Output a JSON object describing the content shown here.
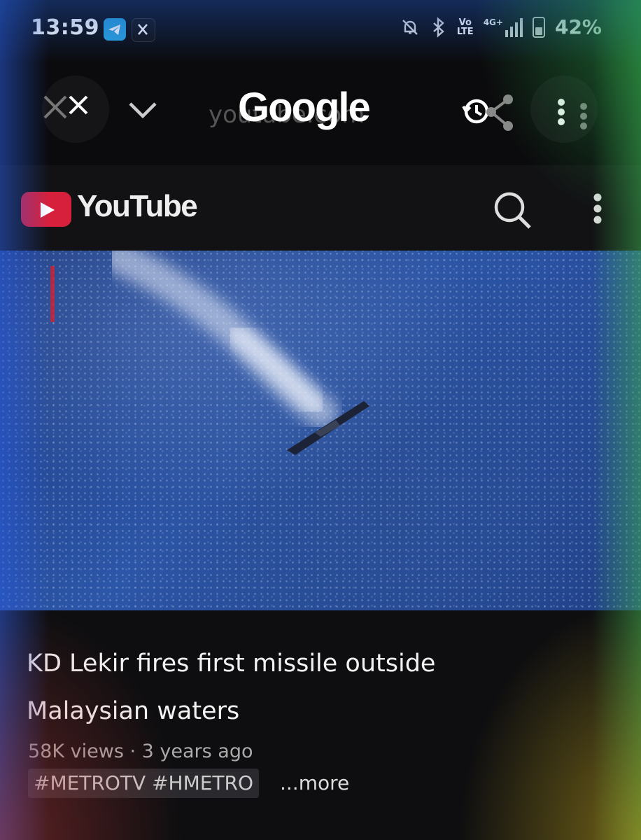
{
  "status_bar": {
    "time": "13:59",
    "network_label_top": "Vo",
    "network_label_bottom": "LTE",
    "signal_label": "4G+",
    "battery_percent": "42%"
  },
  "browser": {
    "ghost_url": "youtube.com",
    "logo_text": "Google"
  },
  "youtube": {
    "logo_text": "YouTube"
  },
  "video": {
    "title_line1": "KD Lekir fires first missile outside",
    "title_line2": "Malaysian waters",
    "meta": "58K views · 3 years ago",
    "tags": "#METROTV #HMETRO",
    "more": "...more"
  }
}
